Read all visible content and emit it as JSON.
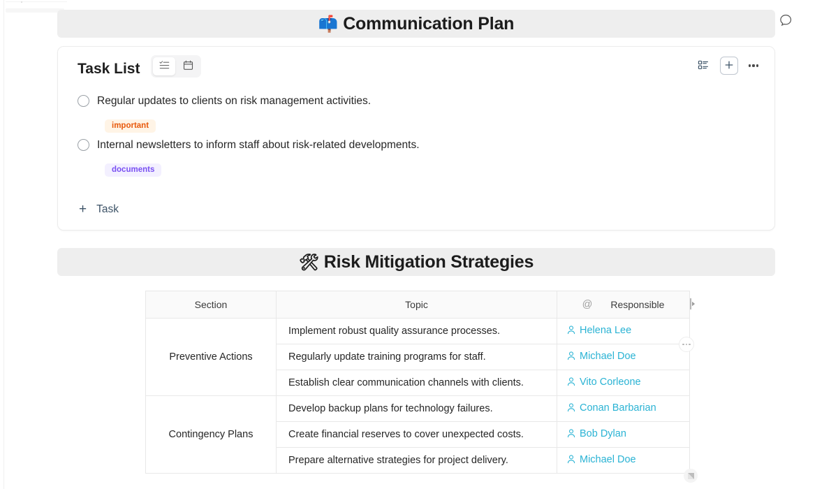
{
  "sections": {
    "communication": {
      "emoji": "📫",
      "title": "Communication Plan"
    },
    "risk": {
      "emoji": "🛠",
      "title": "Risk Mitigation Strategies"
    }
  },
  "topbar": {
    "comment_icon": "comment-bubble-icon"
  },
  "task_card": {
    "title": "Task List",
    "view_toggle": [
      {
        "icon": "checklist-icon",
        "active": true
      },
      {
        "icon": "calendar-icon",
        "active": false
      }
    ],
    "actions": {
      "list_view_icon": "list-view-icon",
      "add_icon": "plus-icon",
      "more_icon": "more-horizontal-icon"
    },
    "tasks": [
      {
        "text": "Regular updates to clients on risk management activities.",
        "checked": false,
        "tag": {
          "label": "important",
          "color": "#e8590c",
          "bg": "#fff4e6"
        }
      },
      {
        "text": "Internal newsletters to inform staff about risk-related developments.",
        "checked": false,
        "tag": {
          "label": "documents",
          "color": "#7950f2",
          "bg": "#f3f0ff"
        }
      }
    ],
    "add_task": {
      "plus": "+",
      "label": "Task"
    }
  },
  "table": {
    "headers": {
      "section": "Section",
      "topic": "Topic",
      "at": "@",
      "responsible": "Responsible"
    },
    "groups": [
      {
        "section": "Preventive Actions",
        "rows": [
          {
            "topic": "Implement robust quality assurance processes.",
            "responsible": "Helena Lee"
          },
          {
            "topic": "Regularly update training programs for staff.",
            "responsible": "Michael Doe"
          },
          {
            "topic": "Establish clear communication channels with clients.",
            "responsible": "Vito Corleone"
          }
        ]
      },
      {
        "section": "Contingency Plans",
        "rows": [
          {
            "topic": "Develop backup plans for technology failures.",
            "responsible": "Conan Barbarian"
          },
          {
            "topic": "Create financial reserves to cover unexpected costs.",
            "responsible": "Bob Dylan"
          },
          {
            "topic": "Prepare alternative strategies for project delivery.",
            "responsible": "Michael Doe"
          }
        ]
      }
    ],
    "controls": {
      "column_handle_icon": "column-resize-handle-icon",
      "row_menu_icon": "row-more-icon",
      "resize_corner_icon": "resize-corner-icon"
    },
    "accent_color": "#2ab3d4"
  }
}
